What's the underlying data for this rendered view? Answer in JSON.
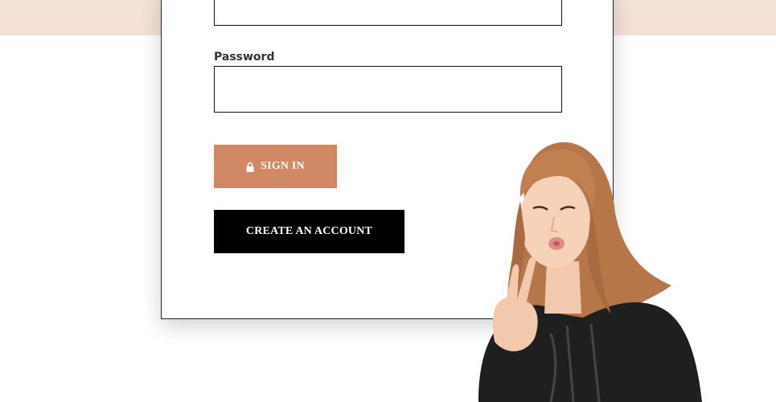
{
  "form": {
    "password_label": "Password",
    "email_value": "",
    "password_value": "",
    "signin_label": "SIGN IN",
    "create_label": "CREATE AN ACCOUNT"
  },
  "icons": {
    "signin_icon": "lock-icon"
  },
  "colors": {
    "top_band": "#f4e1d6",
    "signin_button": "#d08964",
    "create_button": "#000000"
  }
}
